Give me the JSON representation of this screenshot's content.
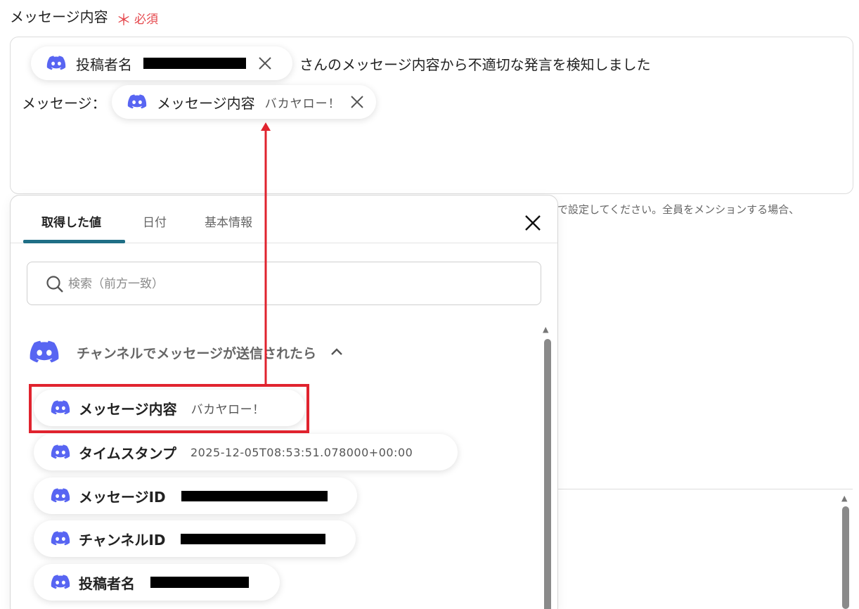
{
  "field": {
    "label": "メッセージ内容",
    "required_mark": "＊",
    "required_text": "必須"
  },
  "editor": {
    "chip_author": {
      "label": "投稿者名",
      "icon": "discord-icon"
    },
    "text_after_author": "さんのメッセージ内容から不適切な発言を検知しました",
    "message_prefix": "メッセージ：",
    "chip_message": {
      "label": "メッセージ内容",
      "value": "バカヤロー！",
      "icon": "discord-icon"
    }
  },
  "hint_text": "で設定してください。全員をメンションする場合、",
  "panel": {
    "tabs": [
      {
        "label": "取得した値",
        "active": true
      },
      {
        "label": "日付",
        "active": false
      },
      {
        "label": "基本情報",
        "active": false
      }
    ],
    "search": {
      "placeholder": "検索（前方一致）"
    },
    "group": {
      "label": "チャンネルでメッセージが送信されたら",
      "icon": "discord-icon",
      "expanded": true
    },
    "items": [
      {
        "label": "メッセージ内容",
        "value": "バカヤロー！"
      },
      {
        "label": "タイムスタンプ",
        "value": "2025-12-05T08:53:51.078000+00:00"
      },
      {
        "label": "メッセージID",
        "value": ""
      },
      {
        "label": "チャンネルID",
        "value": ""
      },
      {
        "label": "投稿者名",
        "value": ""
      }
    ]
  },
  "colors": {
    "discord": "#5865F2",
    "required": "#e5484d",
    "tab_underline": "#1f6f86",
    "highlight": "#e0232e"
  }
}
